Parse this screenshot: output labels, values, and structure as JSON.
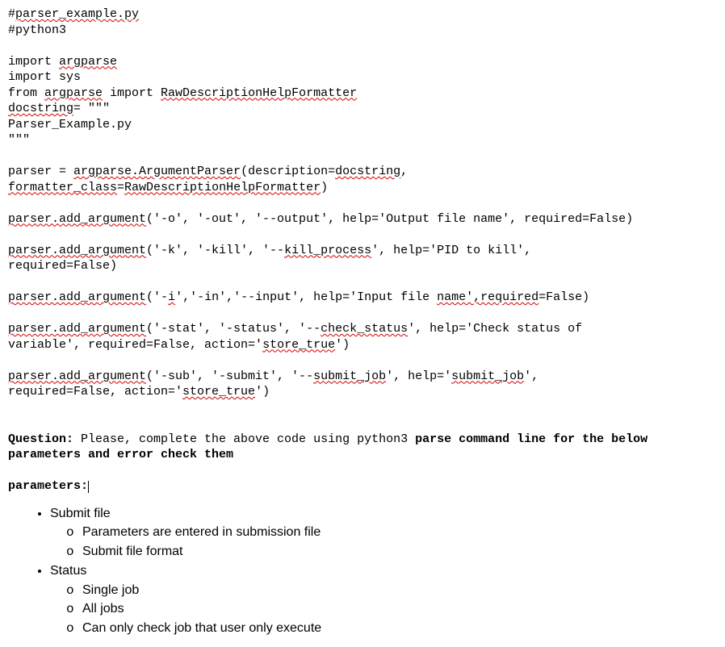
{
  "code": {
    "l1a": "#",
    "l1b": "parser_example.py",
    "l2": "#python3",
    "l3": "",
    "l4a": "import ",
    "l4b": "argparse",
    "l5a": "import ",
    "l5b": "sys",
    "l6a": "from ",
    "l6b": "argparse",
    "l6c": " import ",
    "l6d": "RawDescriptionHelpFormatter",
    "l7a": "docstring",
    "l7b": "= \"\"\"",
    "l8": "Parser_Example.py",
    "l9": "\"\"\"",
    "l10": "",
    "l11a": "parser = ",
    "l11b": "argparse.ArgumentParser",
    "l11c": "(description=",
    "l11d": "docstring",
    "l11e": ",",
    "l12a": "formatter_class",
    "l12b": "=",
    "l12c": "RawDescriptionHelpFormatter",
    "l12d": ")",
    "l13": "",
    "l14a": "parser.add_argument",
    "l14b": "('-o', '-out', '--output', help='Output file name', required=False)",
    "l15": "",
    "l16a": "parser.add_argument",
    "l16b": "('-k', '-kill', '--",
    "l16c": "kill_process",
    "l16d": "', help='PID to kill',",
    "l17": "required=False)",
    "l18": "",
    "l19a": "parser.add_argument",
    "l19b": "('-",
    "l19c": "i",
    "l19d": "','-in','--input', help='Input file ",
    "l19e": "name'",
    "l19f": ",required",
    "l19g": "=False)",
    "l20": "",
    "l21a": "parser.add_argument",
    "l21b": "('-stat', '-status', '--",
    "l21c": "check_status",
    "l21d": "', help='Check status of",
    "l22a": "variable', required=False, action='",
    "l22b": "store_true",
    "l22c": "')",
    "l23": "",
    "l24a": "parser.add_argument",
    "l24b": "('-sub', '-submit', '--",
    "l24c": "submit_job",
    "l24d": "', help='",
    "l24e": "submit_job",
    "l24f": "',",
    "l25a": "required=False, action='",
    "l25b": "store_true",
    "l25c": "')"
  },
  "question": {
    "label": "Question:",
    "text1": " Please, complete the above code using python3 ",
    "bold1": "parse command line for the below parameters and error check them",
    "paramsLabel": "parameters:"
  },
  "list": {
    "item1": "Submit file",
    "item1a": "Parameters are entered in submission file",
    "item1b": "Submit file format",
    "item2": "Status",
    "item2a": "Single job",
    "item2b": "All jobs",
    "item2c": "Can only check job that user only execute"
  }
}
